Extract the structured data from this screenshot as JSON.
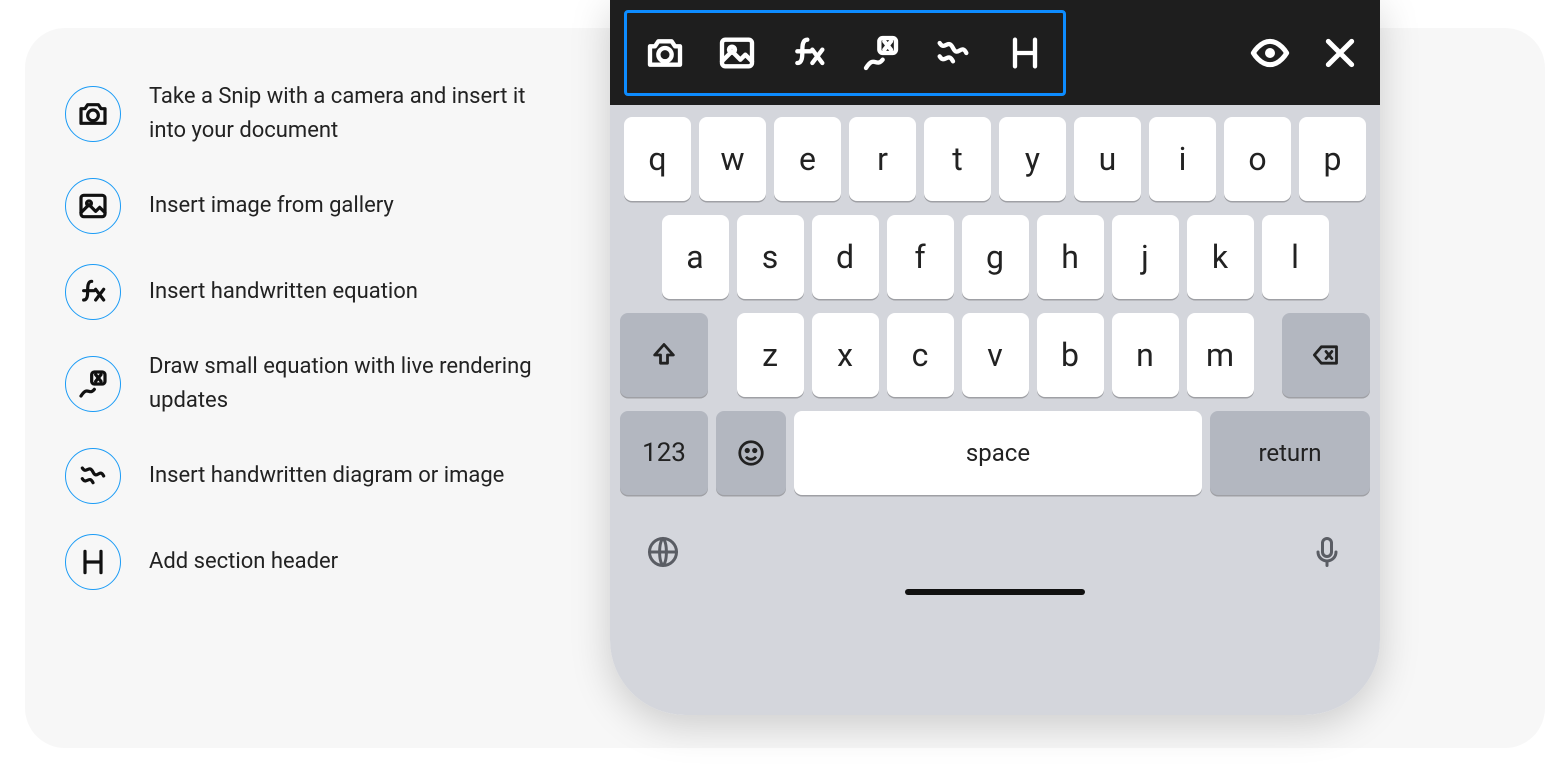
{
  "legend": {
    "items": [
      {
        "icon": "camera-icon",
        "text": "Take a Snip with a camera and insert it into your document"
      },
      {
        "icon": "image-icon",
        "text": "Insert image from gallery"
      },
      {
        "icon": "fx-icon",
        "text": "Insert handwritten equation"
      },
      {
        "icon": "scribble-x-icon",
        "text": "Draw small equation with live rendering updates"
      },
      {
        "icon": "scribble-icon",
        "text": "Insert handwritten diagram or image"
      },
      {
        "icon": "heading-icon",
        "text": "Add section header"
      }
    ]
  },
  "toolbar": {
    "icons": [
      "camera-icon",
      "image-icon",
      "fx-icon",
      "scribble-x-icon",
      "scribble-icon",
      "heading-icon"
    ],
    "preview_icon": "eye-icon",
    "close_icon": "close-icon"
  },
  "keyboard": {
    "row1": [
      "q",
      "w",
      "e",
      "r",
      "t",
      "y",
      "u",
      "i",
      "o",
      "p"
    ],
    "row2": [
      "a",
      "s",
      "d",
      "f",
      "g",
      "h",
      "j",
      "k",
      "l"
    ],
    "row3": [
      "z",
      "x",
      "c",
      "v",
      "b",
      "n",
      "m"
    ],
    "shift_icon": "shift-icon",
    "backspace_icon": "backspace-icon",
    "numbers_label": "123",
    "emoji_icon": "emoji-icon",
    "space_label": "space",
    "return_label": "return",
    "globe_icon": "globe-icon",
    "mic_icon": "mic-icon"
  }
}
